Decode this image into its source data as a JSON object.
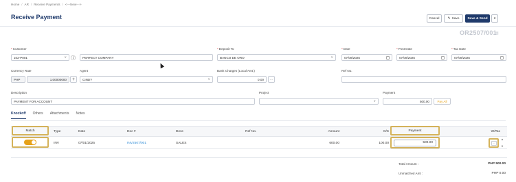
{
  "breadcrumb": {
    "home": "Home",
    "ar": "AR",
    "receive_payments": "Receive Payments",
    "new": "<---New--->",
    "sep": "/"
  },
  "page_title": "Receive Payment",
  "toolbar": {
    "cancel": "Cancel",
    "save": "Save",
    "save_send": "Save & Send",
    "dropdown": "∨",
    "save_icon": "edit-icon"
  },
  "doc_number": "OR2507/001",
  "header_icons": {
    "close": "×",
    "print": "▤"
  },
  "form": {
    "customer": {
      "label": "Customer",
      "code": "102-P001",
      "name": "PERFECT COMPANY",
      "info_icon": "ⓘ"
    },
    "deposit_to": {
      "label": "Deposit To",
      "value": "BANCO DE ORO"
    },
    "date": {
      "label": "Date",
      "value": "07/08/2025"
    },
    "post_date": {
      "label": "Post Date",
      "value": "07/08/2025"
    },
    "tax_date": {
      "label": "Tax Date",
      "value": "07/08/2025"
    },
    "currency_rate": {
      "label": "Currency Rate",
      "currency": "PHP",
      "rate": "1.00000000"
    },
    "agent": {
      "label": "Agent",
      "value": "CINDY"
    },
    "bank_charges": {
      "label": "Bank Charges (Local Amt.)",
      "value": "0.00",
      "more": "···"
    },
    "ref_no": {
      "label": "Ref No.",
      "value": ""
    },
    "description": {
      "label": "Description",
      "value": "PAYMENT FOR ACCOUNT"
    },
    "project": {
      "label": "Project",
      "value": ""
    },
    "payment": {
      "label": "Payment",
      "value": "500.00",
      "pay_all": "Pay All"
    },
    "required": "*",
    "chevron": "∨"
  },
  "tabs": [
    "Knockoff",
    "Others",
    "Attachments",
    "Notes"
  ],
  "table": {
    "headers": {
      "match": "Match",
      "type": "Type",
      "date": "Date",
      "doc": "Doc #",
      "desc": "Desc",
      "ref": "Ref No.",
      "amount": "Amount",
      "os": "O/S",
      "payment": "Payment",
      "wtax": "W/Tax"
    },
    "rows": [
      {
        "match": true,
        "type": "INV",
        "date": "07/01/2025",
        "doc": "INV2507/001",
        "desc": "SALES",
        "ref": "",
        "amount": "600.00",
        "os": "100.00",
        "payment": "500.00",
        "wtax": "···"
      }
    ]
  },
  "totals": {
    "total_label": "Total Amount :",
    "total_value": "PHP 500.00",
    "unmatched_label": "Unmatched Amt :",
    "unmatched_value": "PHP 0.00"
  },
  "colors": {
    "brand": "#1f3a6b",
    "accent": "#e6a21a",
    "link": "#2b8ad6",
    "highlight": "#d4b25a",
    "required": "#e23b3b"
  }
}
